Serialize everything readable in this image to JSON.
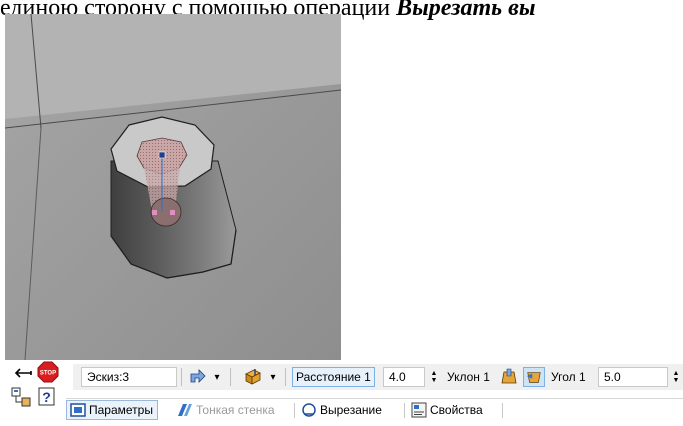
{
  "document": {
    "text_prefix": "единою сторону с помощью операции ",
    "text_emphasis": "Вырезать вы"
  },
  "viewport": {
    "background": "#9a9a9a",
    "model": "cylinder-boss-with-sketch"
  },
  "left_tools": {
    "back_icon": "arrow-left-icon",
    "stop_icon": "stop-icon",
    "stop_label": "STOP",
    "tree_icon": "tree-icon",
    "help_icon": "help-icon",
    "help_glyph": "?"
  },
  "toolbar": {
    "sketch_field": "Эскиз:3",
    "distance_label": "Расстояние 1",
    "distance_value": "4.0",
    "slope_label": "Уклон 1",
    "angle_label": "Угол 1",
    "angle_value": "5.0",
    "dropdown_glyph": "▾",
    "spin_up": "▲",
    "spin_down": "▼"
  },
  "tabs": [
    {
      "label": "Параметры",
      "icon": "parameters-icon",
      "active": true,
      "enabled": true
    },
    {
      "label": "Тонкая стенка",
      "icon": "thin-wall-icon",
      "active": false,
      "enabled": false
    },
    {
      "label": "Вырезание",
      "icon": "cut-icon",
      "active": false,
      "enabled": true
    },
    {
      "label": "Свойства",
      "icon": "properties-icon",
      "active": false,
      "enabled": true
    }
  ],
  "colors": {
    "accent": "#2f6fc7",
    "stop_red": "#d81e1e",
    "toolbar_bg": "#f0f0f0",
    "disabled_text": "#9a9a9a"
  }
}
